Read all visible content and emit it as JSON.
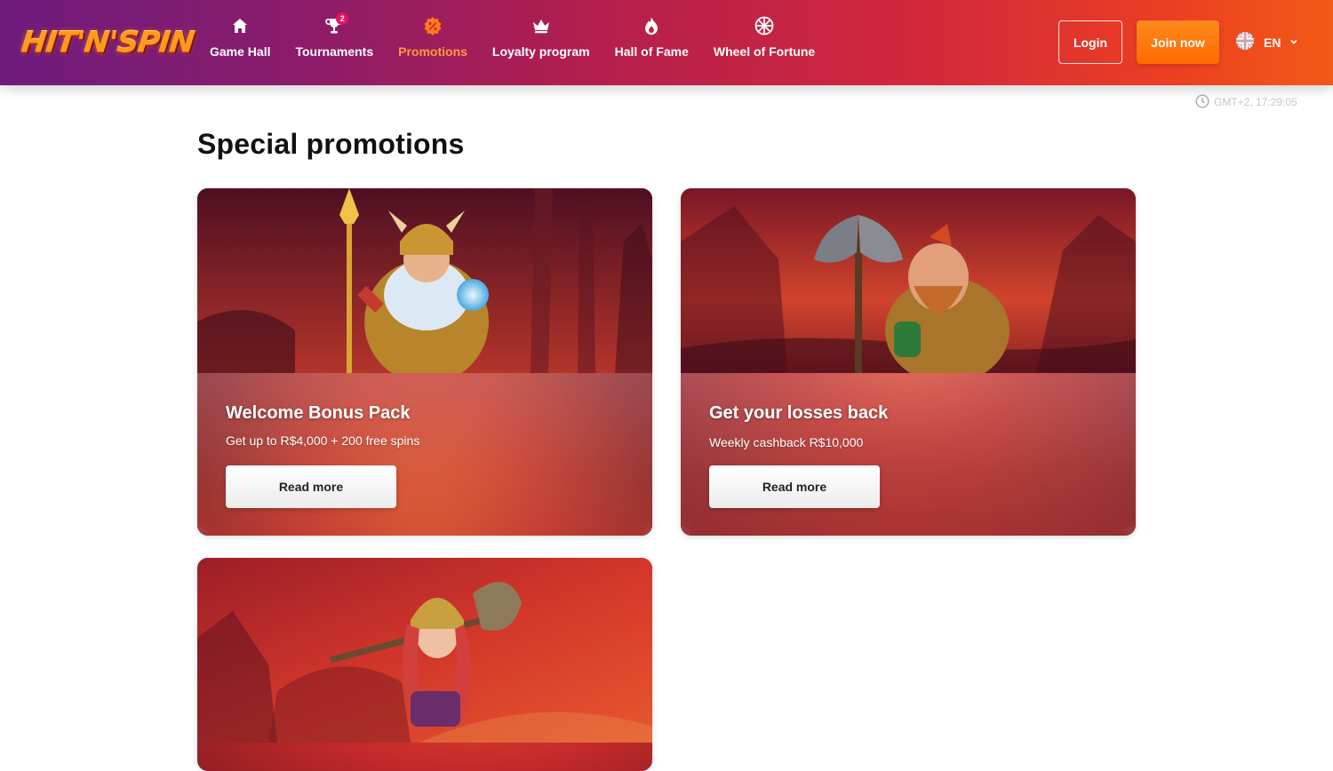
{
  "header": {
    "logo_text": "HIT'N'SPIN",
    "nav": [
      {
        "label": "Game Hall",
        "icon": "house-icon"
      },
      {
        "label": "Tournaments",
        "icon": "trophy-icon",
        "badge": "2"
      },
      {
        "label": "Promotions",
        "icon": "promo-badge-icon",
        "active": true
      },
      {
        "label": "Loyalty program",
        "icon": "crown-icon"
      },
      {
        "label": "Hall of Fame",
        "icon": "flame-icon"
      },
      {
        "label": "Wheel of Fortune",
        "icon": "wheel-icon"
      }
    ],
    "login_label": "Login",
    "join_label": "Join now",
    "language": "EN"
  },
  "clock": {
    "text": "GMT+2, 17:29:05"
  },
  "page_title": "Special promotions",
  "promotions": [
    {
      "title": "Welcome Bonus Pack",
      "subtitle": "Get up to R$4,000 + 200 free spins",
      "button": "Read more"
    },
    {
      "title": "Get your losses back",
      "subtitle": "Weekly cashback R$10,000",
      "button": "Read more"
    },
    {
      "title": "",
      "subtitle": "",
      "button": ""
    }
  ],
  "colors": {
    "header_start": "#6e1b7d",
    "header_end": "#f25a17",
    "active_nav": "#ff9a3c",
    "join_button": "#ff6a00",
    "badge": "#e0165e"
  }
}
